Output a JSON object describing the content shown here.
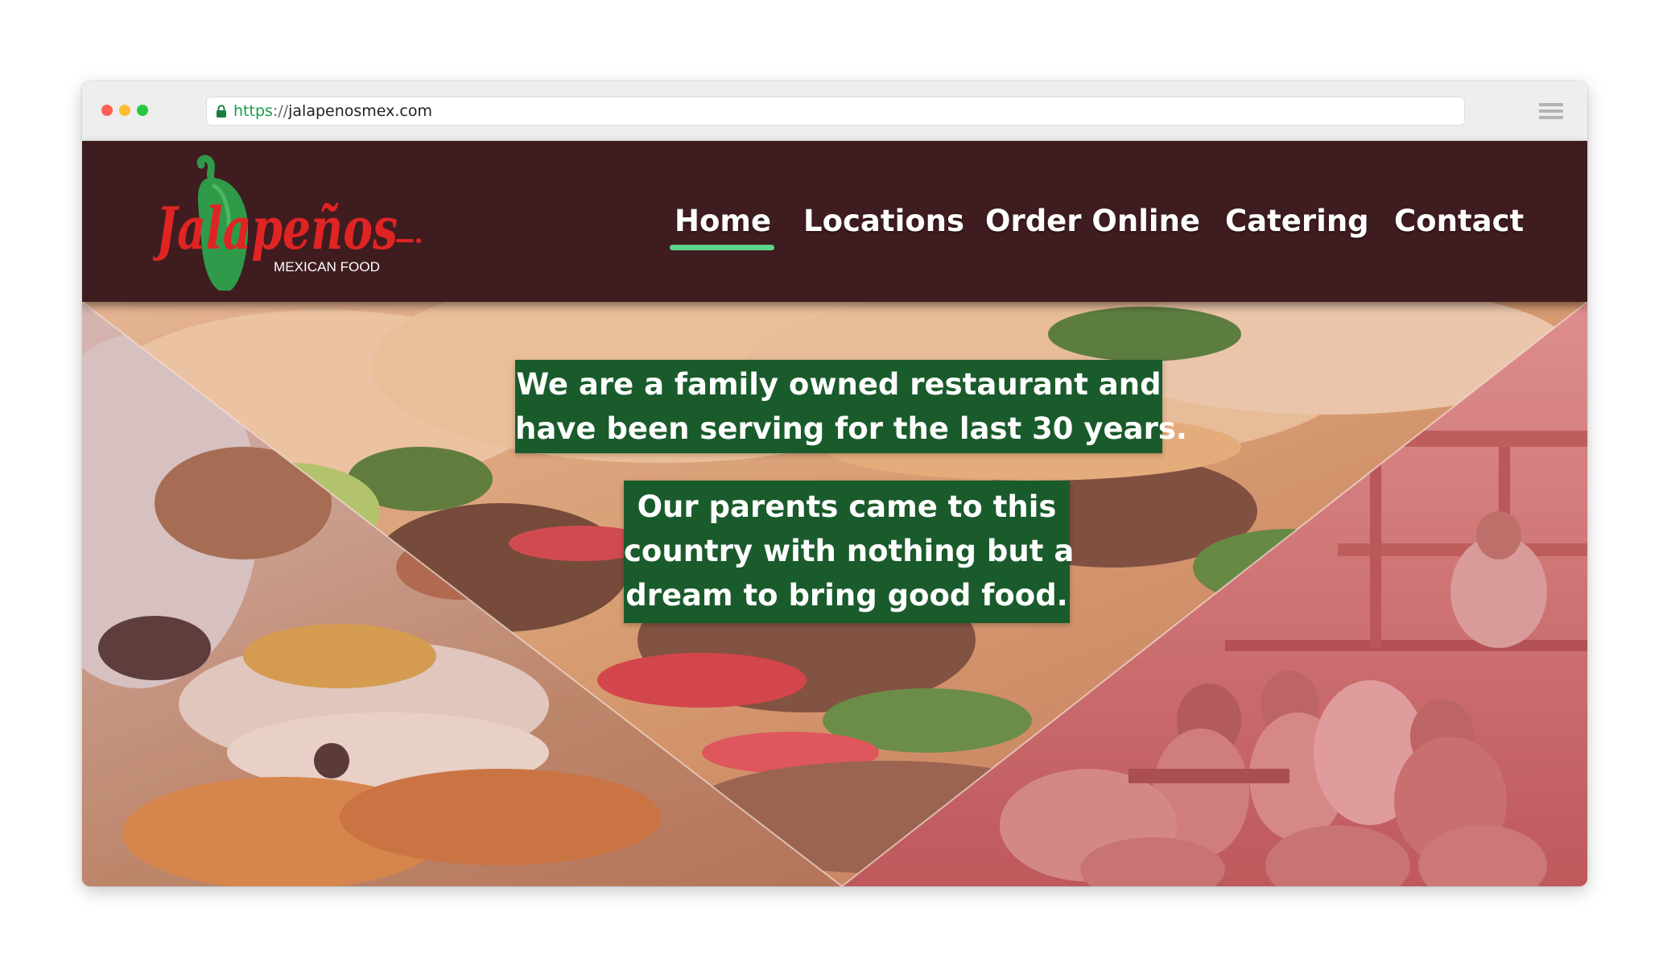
{
  "browser": {
    "url_scheme": "https",
    "url_separator": "://",
    "url_host": "jalapenosmex.com",
    "traffic_lights": [
      "#ff5f57",
      "#febc2e",
      "#28c840"
    ]
  },
  "logo": {
    "wordmark": "Jalapeños",
    "tagline": "MEXICAN FOOD",
    "wordmark_color": "#e02424",
    "pepper_color": "#2f9a4a"
  },
  "nav": {
    "items": [
      {
        "label": "Home",
        "active": true
      },
      {
        "label": "Locations",
        "active": false
      },
      {
        "label": "Order Online",
        "active": false
      },
      {
        "label": "Catering",
        "active": false
      },
      {
        "label": "Contact",
        "active": false
      }
    ],
    "active_indicator_color": "#5bd38d",
    "background_color": "#3f1c1f"
  },
  "hero": {
    "lines_1": [
      "We are a family owned restaurant and",
      "have been serving for the last 30 years."
    ],
    "lines_2": [
      "Our parents came to this",
      "country with nothing but a",
      "dream to bring good food."
    ],
    "callout_color": "#1a5b2c",
    "overlay_color": "#cf5a5f"
  }
}
